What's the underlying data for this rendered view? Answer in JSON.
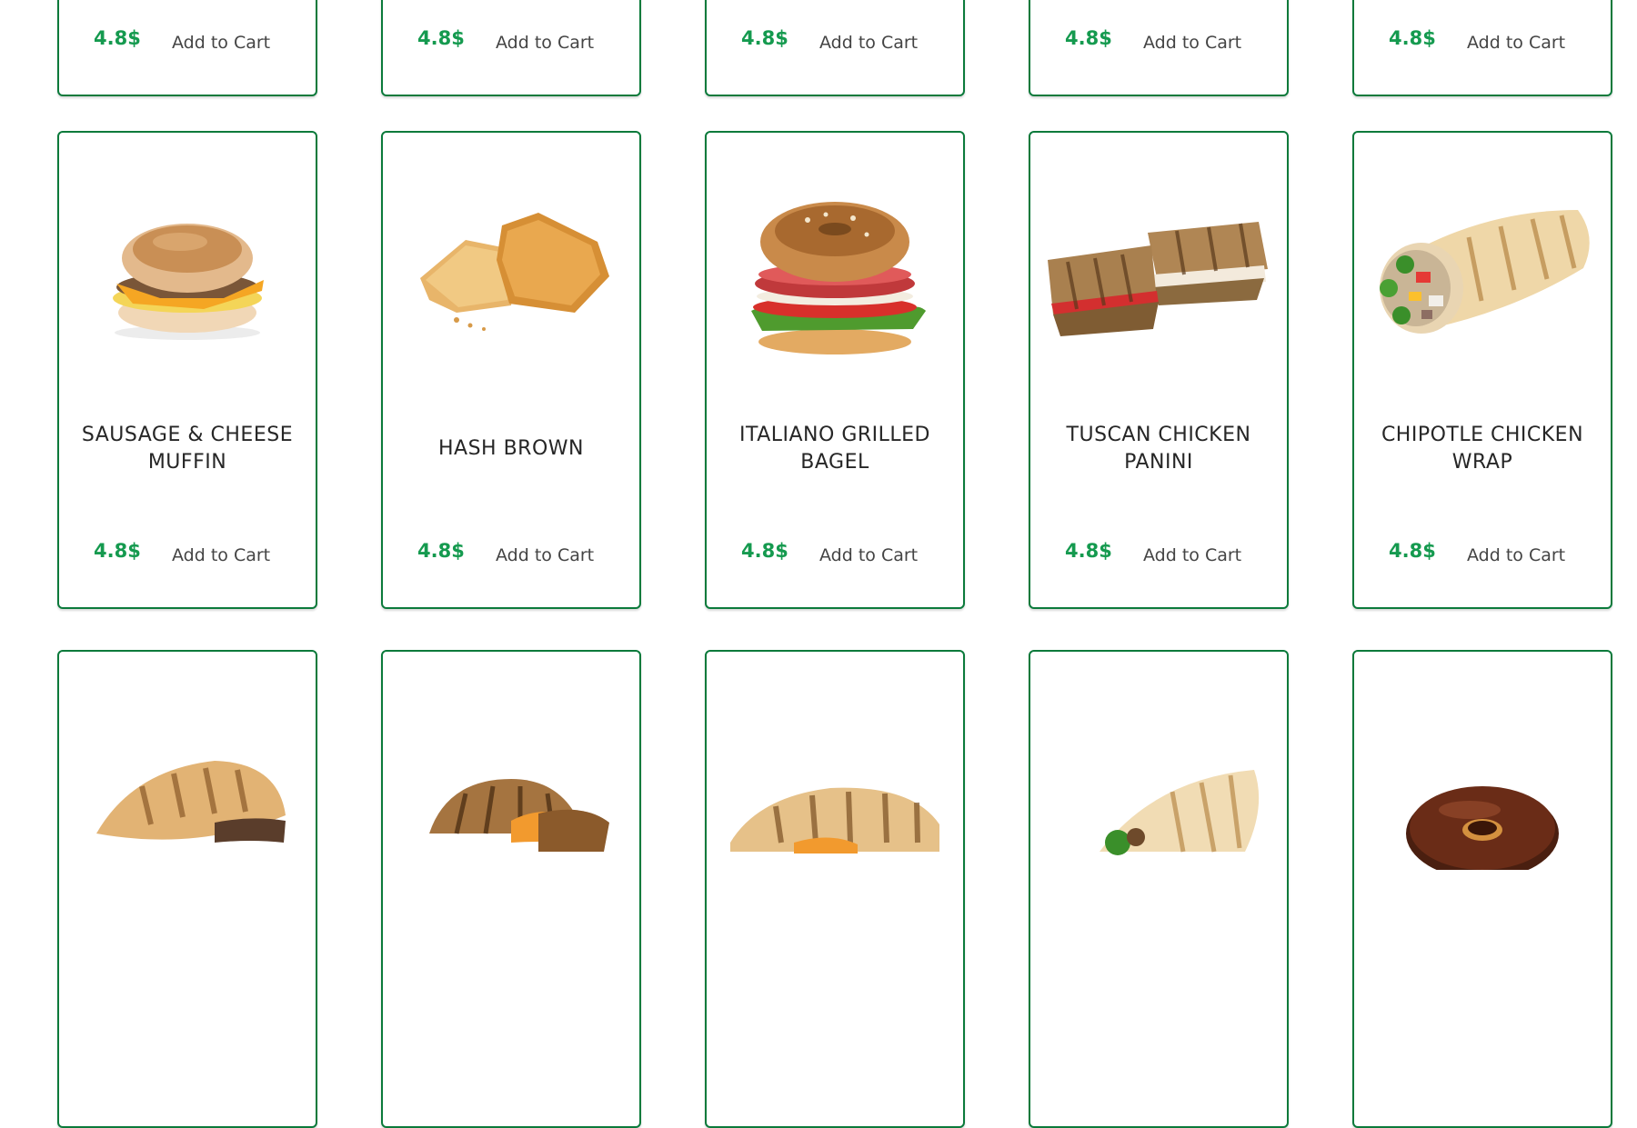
{
  "colors": {
    "card_border": "#0b7a3b",
    "price_green": "#159a4f",
    "title_text": "#262626",
    "cart_text": "#444444"
  },
  "top_row": [
    {
      "price": "4.8$",
      "cart_label": "Add to Cart"
    },
    {
      "price": "4.8$",
      "cart_label": "Add to Cart"
    },
    {
      "price": "4.8$",
      "cart_label": "Add to Cart"
    },
    {
      "price": "4.8$",
      "cart_label": "Add to Cart"
    },
    {
      "price": "4.8$",
      "cart_label": "Add to Cart"
    }
  ],
  "middle_row": [
    {
      "name": "SAUSAGE & CHEESE MUFFIN",
      "price": "4.8$",
      "cart_label": "Add to Cart",
      "image_icon": "muffin-sandwich-image"
    },
    {
      "name": "HASH BROWN",
      "price": "4.8$",
      "cart_label": "Add to Cart",
      "image_icon": "hash-brown-image"
    },
    {
      "name": "ITALIANO GRILLED BAGEL",
      "price": "4.8$",
      "cart_label": "Add to Cart",
      "image_icon": "bagel-sandwich-image"
    },
    {
      "name": "TUSCAN CHICKEN PANINI",
      "price": "4.8$",
      "cart_label": "Add to Cart",
      "image_icon": "panini-image"
    },
    {
      "name": "CHIPOTLE CHICKEN WRAP",
      "price": "4.8$",
      "cart_label": "Add to Cart",
      "image_icon": "wrap-image"
    }
  ],
  "bottom_row": [
    {
      "image_icon": "grilled-sub-image"
    },
    {
      "image_icon": "grilled-panini-image"
    },
    {
      "image_icon": "grilled-melt-image"
    },
    {
      "image_icon": "grilled-wrap-image"
    },
    {
      "image_icon": "chocolate-donut-image"
    }
  ]
}
